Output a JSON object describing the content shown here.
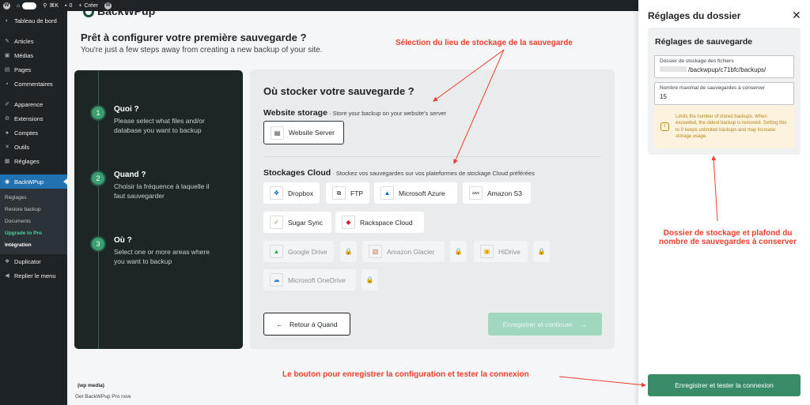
{
  "adminbar": {
    "new_label": "Créer",
    "comments_count": "0",
    "shortcut": "⌘K"
  },
  "sidebar": {
    "items_top": [
      {
        "label": "Tableau de bord",
        "icon": "dashboard-icon"
      },
      {
        "label": "Articles",
        "icon": "pin-icon"
      },
      {
        "label": "Médias",
        "icon": "media-icon"
      },
      {
        "label": "Pages",
        "icon": "page-icon"
      },
      {
        "label": "Commentaires",
        "icon": "comment-icon"
      },
      {
        "label": "Apparence",
        "icon": "brush-icon"
      },
      {
        "label": "Extensions",
        "icon": "plugin-icon"
      },
      {
        "label": "Comptes",
        "icon": "user-icon"
      },
      {
        "label": "Outils",
        "icon": "wrench-icon"
      },
      {
        "label": "Réglages",
        "icon": "settings-icon"
      }
    ],
    "active": {
      "label": "BackWPup",
      "icon": "backwpup-icon"
    },
    "submenu": [
      "Réglages",
      "Restore backup",
      "Documents",
      "Upgrade to Pro",
      "Intégration"
    ],
    "items_bottom": [
      {
        "label": "Duplicator",
        "icon": "duplicator-icon"
      },
      {
        "label": "Replier le menu",
        "icon": "collapse-icon"
      }
    ]
  },
  "main": {
    "logo_text": "BackWPup",
    "title": "Prêt à configurer votre première sauvegarde ?",
    "subtitle": "You're just a few steps away from creating a new backup of your site.",
    "steps": [
      {
        "num": "1",
        "title": "Quoi ?",
        "desc": "Please select what files and/or database you want to backup"
      },
      {
        "num": "2",
        "title": "Quand ?",
        "desc": "Choisir la fréquence à laquelle il faut sauvegarder"
      },
      {
        "num": "3",
        "title": "Où ?",
        "desc": "Select one or more areas where you want to backup"
      }
    ],
    "panel_title": "Où stocker votre sauvegarde ?",
    "website_storage": {
      "title": "Website storage",
      "sub": " · Store your backup on your website's server",
      "option": "Website Server"
    },
    "cloud": {
      "title": "Stockages Cloud",
      "sub": " · Stockez vos sauvegardes sur vos plateformes de stockage Cloud préférées",
      "options": [
        "Dropbox",
        "FTP",
        "Microsoft Azure",
        "Amazon S3",
        "Sugar Sync",
        "Rackspace Cloud"
      ],
      "locked": [
        "Google Drive",
        "Amazon Glacier",
        "HiDrive",
        "Microsoft OneDrive"
      ]
    },
    "back_label": "Retour à Quand",
    "save_label": "Enregistrer et continuer",
    "footer_logo": "(wp media)",
    "footer_text": "Get BackWPup Pro now."
  },
  "drawer": {
    "title": "Réglages du dossier",
    "card_title": "Réglages de sauvegarde",
    "folder_label": "Dossier de stockage des fichiers",
    "folder_value": "/backwpup/c71bfc/backups/",
    "max_label": "Nombre maximal de sauvegardes à conserver",
    "max_value": "15",
    "warning": "Limits the number of stored backups. When exceeded, the oldest backup is removed. Setting this to 0 keeps unlimited backups and may increase storage usage.",
    "button": "Enregistrer et tester la connexion"
  },
  "annotations": {
    "storage_location": "Sélection du lieu de stockage de la sauvegarde",
    "folder_limit_1": "Dossier de stockage et plafond du",
    "folder_limit_2": "nombre de sauvegardes à conserver",
    "save_test": "Le bouton pour enregistrer la configuration et tester la connexion"
  },
  "colors": {
    "annotation": "#e8412f",
    "accent_green": "#3a8c68",
    "wp_dark": "#1d2327",
    "wp_blue": "#2271b1"
  }
}
